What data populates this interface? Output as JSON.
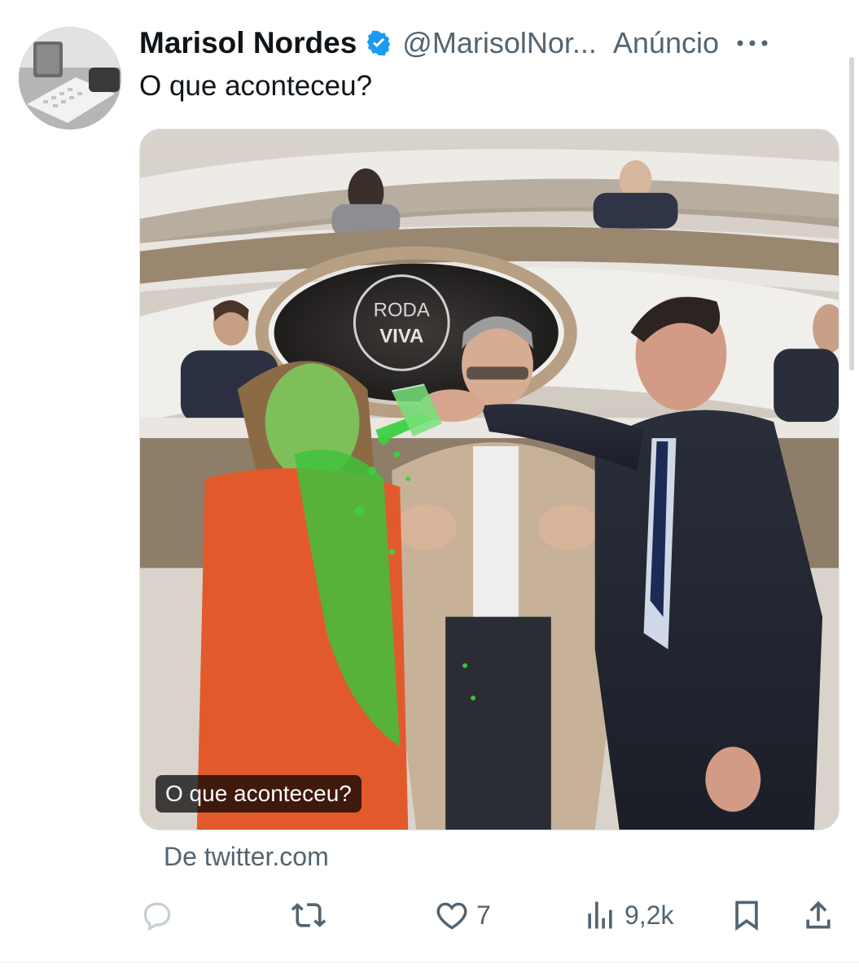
{
  "tweet": {
    "author_name": "Marisol Nordes",
    "handle": "@MarisolNor...",
    "ad_label": "Anúncio",
    "text": "O que aconteceu?",
    "media": {
      "caption": "O que aconteceu?",
      "sign_line1": "RODA",
      "sign_line2": "VIVA"
    },
    "source": "De twitter.com",
    "actions": {
      "likes": "7",
      "views": "9,2k"
    }
  },
  "colors": {
    "verified": "#1d9bf0",
    "icon_gray": "#536471",
    "text_dark": "#0f1419"
  },
  "icons": [
    "verified-badge-icon",
    "more-icon",
    "reply-icon",
    "retweet-icon",
    "like-icon",
    "views-icon",
    "bookmark-icon",
    "share-icon"
  ]
}
